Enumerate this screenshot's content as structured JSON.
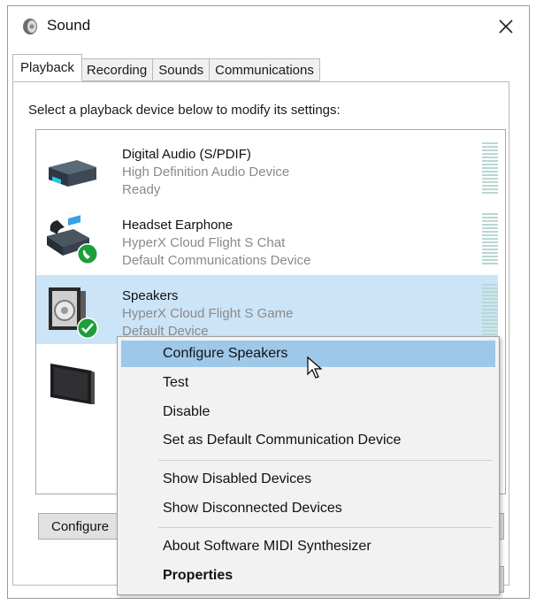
{
  "window": {
    "title": "Sound"
  },
  "tabs": [
    {
      "label": "Playback",
      "active": true
    },
    {
      "label": "Recording",
      "active": false
    },
    {
      "label": "Sounds",
      "active": false
    },
    {
      "label": "Communications",
      "active": false
    }
  ],
  "instruction": "Select a playback device below to modify its settings:",
  "devices": [
    {
      "name": "Digital Audio (S/PDIF)",
      "description": "High Definition Audio Device",
      "status": "Ready",
      "icon": "digital-audio-device-icon"
    },
    {
      "name": "Headset Earphone",
      "description": "HyperX Cloud Flight S Chat",
      "status": "Default Communications Device",
      "icon": "headset-phone-icon"
    },
    {
      "name": "Speakers",
      "description": "HyperX Cloud Flight S Game",
      "status": "Default Device",
      "icon": "speaker-icon",
      "selected": true
    },
    {
      "name": "",
      "description": "",
      "status": "",
      "icon": "monitor-icon"
    }
  ],
  "buttons": {
    "configure": "Configure"
  },
  "context_menu": {
    "items": [
      {
        "label": "Configure Speakers",
        "highlighted": true
      },
      {
        "label": "Test"
      },
      {
        "label": "Disable"
      },
      {
        "label": "Set as Default Communication Device"
      },
      {
        "label": "Show Disabled Devices"
      },
      {
        "label": "Show Disconnected Devices"
      },
      {
        "label": "About Software MIDI Synthesizer"
      },
      {
        "label": "Properties",
        "bold": true
      }
    ]
  },
  "colors": {
    "selection": "#cce4f7",
    "menu_highlight": "#9ec8ea",
    "default_check": "#1e9e3a",
    "level_meter": "#b8d8d2"
  }
}
